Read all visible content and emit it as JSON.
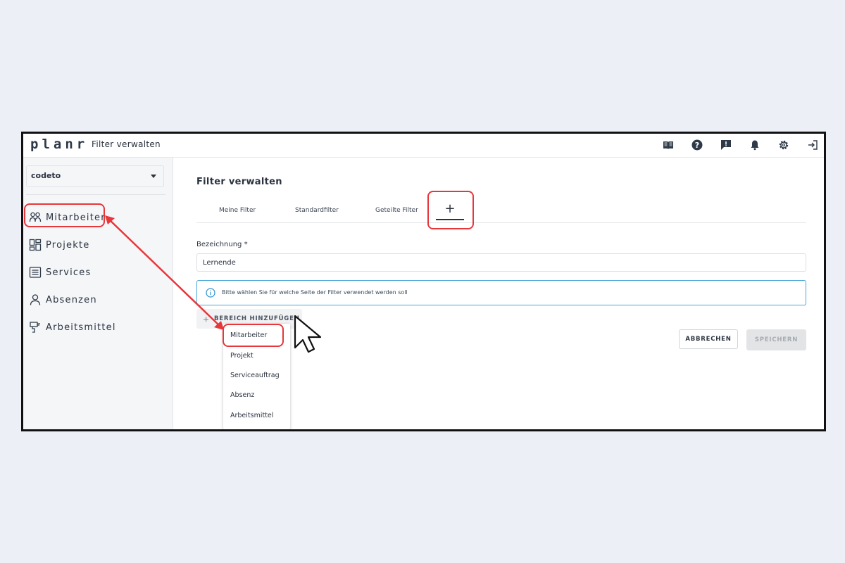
{
  "app": {
    "logo": "planr",
    "title": "Filter verwalten"
  },
  "topbar_icons": [
    "book-icon",
    "help-icon",
    "feedback-icon",
    "bell-icon",
    "gear-icon",
    "logout-icon"
  ],
  "sidebar": {
    "organization": "codeto",
    "items": [
      {
        "label": "Mitarbeiter",
        "icon": "people-icon"
      },
      {
        "label": "Projekte",
        "icon": "dashboard-icon"
      },
      {
        "label": "Services",
        "icon": "list-icon"
      },
      {
        "label": "Absenzen",
        "icon": "person-icon"
      },
      {
        "label": "Arbeitsmittel",
        "icon": "tool-icon"
      }
    ]
  },
  "main": {
    "title": "Filter verwalten",
    "tabs": [
      "Meine Filter",
      "Standardfilter",
      "Geteilte Filter"
    ],
    "add_tab": "+",
    "field_label": "Bezeichnung *",
    "field_value": "Lernende",
    "info_text": "Bitte wählen Sie für welche Seite der Filter verwendet werden soll",
    "add_area_label": "BEREICH HINZUFÜGEN",
    "cancel_label": "ABBRECHEN",
    "save_label": "SPEICHERN",
    "dropdown": [
      "Mitarbeiter",
      "Projekt",
      "Serviceauftrag",
      "Absenz",
      "Arbeitsmittel"
    ]
  },
  "colors": {
    "highlight": "#e8363a",
    "info_border": "#4aa6d8",
    "background": "#eceff6"
  }
}
